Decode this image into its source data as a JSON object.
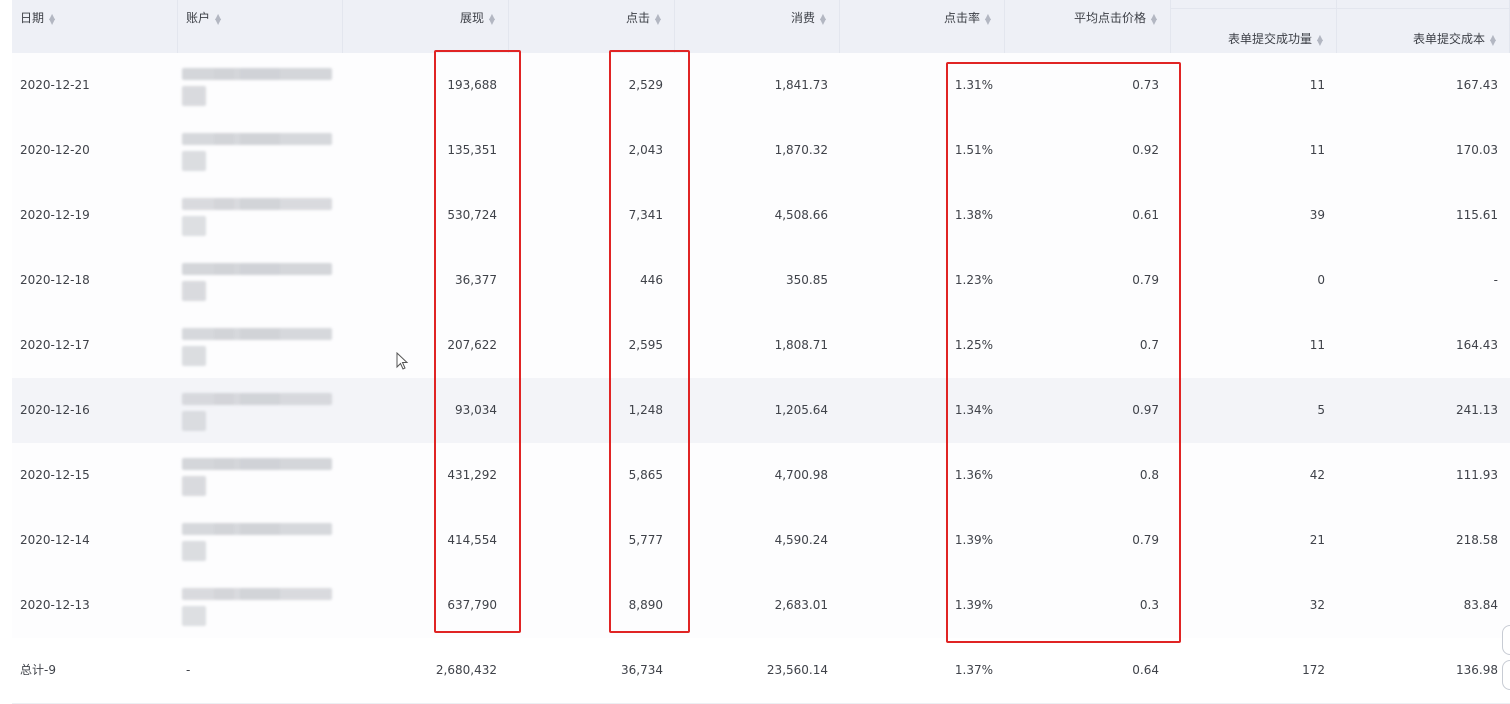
{
  "columns": [
    {
      "key": "date",
      "label": "日期",
      "align": "left"
    },
    {
      "key": "account",
      "label": "账户",
      "align": "left"
    },
    {
      "key": "impressions",
      "label": "展现",
      "align": "right"
    },
    {
      "key": "clicks",
      "label": "点击",
      "align": "right"
    },
    {
      "key": "spend",
      "label": "消费",
      "align": "right"
    },
    {
      "key": "ctr",
      "label": "点击率",
      "align": "right"
    },
    {
      "key": "cpc",
      "label": "平均点击价格",
      "align": "right"
    },
    {
      "key": "form_success",
      "label": "表单提交成功量",
      "align": "right"
    },
    {
      "key": "form_cost",
      "label": "表单提交成本",
      "align": "right"
    }
  ],
  "rows": [
    {
      "date": "2020-12-21",
      "impressions": "193,688",
      "clicks": "2,529",
      "spend": "1,841.73",
      "ctr": "1.31%",
      "cpc": "0.73",
      "form_success": "11",
      "form_cost": "167.43"
    },
    {
      "date": "2020-12-20",
      "impressions": "135,351",
      "clicks": "2,043",
      "spend": "1,870.32",
      "ctr": "1.51%",
      "cpc": "0.92",
      "form_success": "11",
      "form_cost": "170.03"
    },
    {
      "date": "2020-12-19",
      "impressions": "530,724",
      "clicks": "7,341",
      "spend": "4,508.66",
      "ctr": "1.38%",
      "cpc": "0.61",
      "form_success": "39",
      "form_cost": "115.61"
    },
    {
      "date": "2020-12-18",
      "impressions": "36,377",
      "clicks": "446",
      "spend": "350.85",
      "ctr": "1.23%",
      "cpc": "0.79",
      "form_success": "0",
      "form_cost": "-"
    },
    {
      "date": "2020-12-17",
      "impressions": "207,622",
      "clicks": "2,595",
      "spend": "1,808.71",
      "ctr": "1.25%",
      "cpc": "0.7",
      "form_success": "11",
      "form_cost": "164.43"
    },
    {
      "date": "2020-12-16",
      "impressions": "93,034",
      "clicks": "1,248",
      "spend": "1,205.64",
      "ctr": "1.34%",
      "cpc": "0.97",
      "form_success": "5",
      "form_cost": "241.13"
    },
    {
      "date": "2020-12-15",
      "impressions": "431,292",
      "clicks": "5,865",
      "spend": "4,700.98",
      "ctr": "1.36%",
      "cpc": "0.8",
      "form_success": "42",
      "form_cost": "111.93"
    },
    {
      "date": "2020-12-14",
      "impressions": "414,554",
      "clicks": "5,777",
      "spend": "4,590.24",
      "ctr": "1.39%",
      "cpc": "0.79",
      "form_success": "21",
      "form_cost": "218.58"
    },
    {
      "date": "2020-12-13",
      "impressions": "637,790",
      "clicks": "8,890",
      "spend": "2,683.01",
      "ctr": "1.39%",
      "cpc": "0.3",
      "form_success": "32",
      "form_cost": "83.84"
    }
  ],
  "total": {
    "date": "总计-9",
    "account": "-",
    "impressions": "2,680,432",
    "clicks": "36,734",
    "spend": "23,560.14",
    "ctr": "1.37%",
    "cpc": "0.64",
    "form_success": "172",
    "form_cost": "136.98"
  },
  "highlight_color": "#e02424",
  "hovered_row_index": 5
}
